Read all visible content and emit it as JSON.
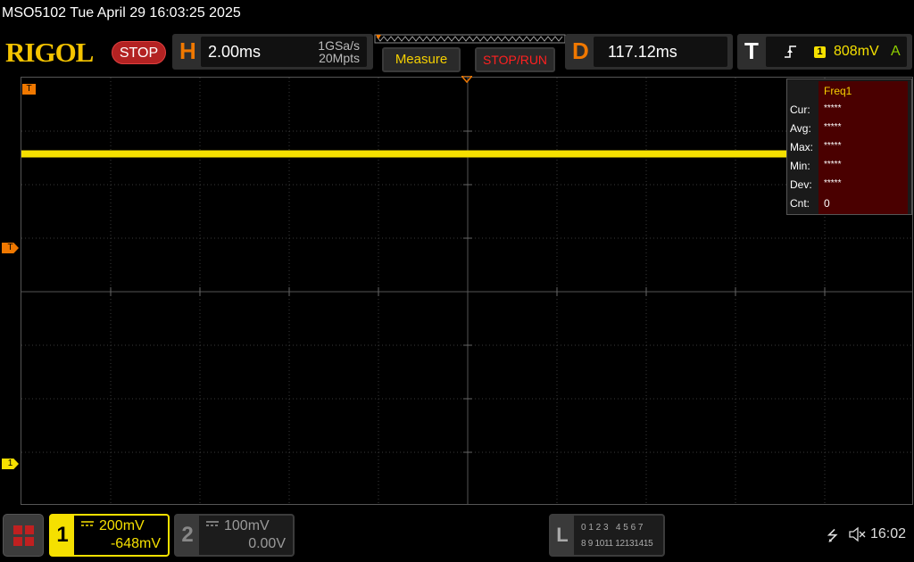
{
  "title_bar": {
    "text": "MSO5102  Tue April 29 16:03:25 2025"
  },
  "brand": {
    "logo": "RIGOL",
    "run_state": "STOP"
  },
  "horizontal": {
    "letter": "H",
    "timebase": "2.00ms",
    "sample_rate": "1GSa/s",
    "mem_depth": "20Mpts"
  },
  "buttons": {
    "measure": "Measure",
    "stop_run": "STOP/RUN"
  },
  "delay": {
    "letter": "D",
    "value": "117.12ms"
  },
  "trigger": {
    "letter": "T",
    "edge_icon": "rising-edge-icon",
    "source": "1",
    "level": "808mV",
    "mode": "A"
  },
  "markers": {
    "trigger_top": "T",
    "trigger_level": "T",
    "ch1_ground": "1"
  },
  "measurement_panel": {
    "title": "Freq1",
    "rows": [
      {
        "label": "Cur:",
        "value": "*****"
      },
      {
        "label": "Avg:",
        "value": "*****"
      },
      {
        "label": "Max:",
        "value": "*****"
      },
      {
        "label": "Min:",
        "value": "*****"
      },
      {
        "label": "Dev:",
        "value": "*****"
      },
      {
        "label": "Cnt:",
        "value": "0"
      }
    ]
  },
  "channel1": {
    "number": "1",
    "scale": "200mV",
    "offset": "-648mV",
    "color": "#f5e000",
    "coupling_icon": "dc-coupling-icon"
  },
  "channel2": {
    "number": "2",
    "scale": "100mV",
    "offset": "0.00V",
    "color": "#9a9a9a",
    "coupling_icon": "dc-coupling-icon"
  },
  "logic": {
    "letter": "L",
    "row1": "0 1 2 3   4 5 6 7",
    "row2": "8 9 1011 12131415"
  },
  "status": {
    "usb_icon": "usb-icon",
    "speaker_icon": "speaker-muted-icon",
    "time": "16:02"
  },
  "colors": {
    "trigger_orange": "#f07800",
    "ch1_yellow": "#f5e000",
    "stop_red": "#b32222",
    "panel_red": "#4a0000"
  }
}
